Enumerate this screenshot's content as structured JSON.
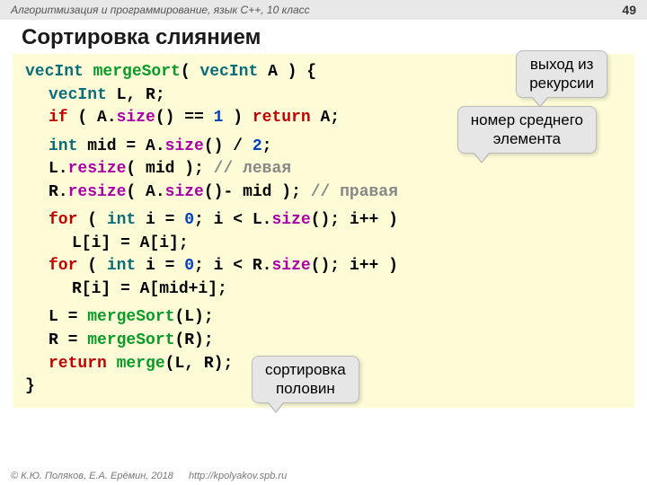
{
  "header": {
    "course": "Алгоритмизация и программирование, язык C++, 10 класс",
    "page": "49"
  },
  "title": "Сортировка слиянием",
  "callouts": {
    "c1": "выход из\nрекурсии",
    "c2": "номер среднего\nэлемента",
    "c3": "сортировка\nполовин"
  },
  "code": {
    "l1": {
      "type": "vecInt",
      "func": "mergeSort",
      "paren_open": "( ",
      "ptype": "vecInt",
      "pvar": " A ) {"
    },
    "l2": {
      "type": "vecInt",
      "vars": " L, R;"
    },
    "l3": {
      "kw1": "if",
      "a": " ( A.",
      "m": "size",
      "b": "() == ",
      "n": "1",
      "c": " ) ",
      "kw2": "return",
      "d": " A;"
    },
    "l4": {
      "type": "int",
      "a": " mid = A.",
      "m": "size",
      "b": "() / ",
      "n": "2",
      "c": ";"
    },
    "l5": {
      "a": "L.",
      "m": "resize",
      "b": "( mid );  ",
      "cm": "// левая"
    },
    "l6": {
      "a": "R.",
      "m": "resize",
      "b": "( A.",
      "m2": "size",
      "c": "()- mid ); ",
      "cm": "// правая"
    },
    "l7": {
      "kw1": "for",
      "a": " ( ",
      "type": "int",
      "b": " i = ",
      "n": "0",
      "c": "; i < L.",
      "m": "size",
      "d": "(); i++ )"
    },
    "l8": {
      "a": "L[i] = A[i];"
    },
    "l9": {
      "kw1": "for",
      "a": " ( ",
      "type": "int",
      "b": " i = ",
      "n": "0",
      "c": "; i < R.",
      "m": "size",
      "d": "(); i++ )"
    },
    "l10": {
      "a": "R[i] = A[mid+i];"
    },
    "l11": {
      "a": "L = ",
      "f": "mergeSort",
      "b": "(L);"
    },
    "l12": {
      "a": "R = ",
      "f": "mergeSort",
      "b": "(R);"
    },
    "l13": {
      "kw": "return",
      "a": " ",
      "f": "merge",
      "b": "(L, R);"
    },
    "l14": {
      "a": "}"
    }
  },
  "footer": {
    "copy": "© К.Ю. Поляков, Е.А. Ерёмин, 2018",
    "url": "http://kpolyakov.spb.ru"
  }
}
